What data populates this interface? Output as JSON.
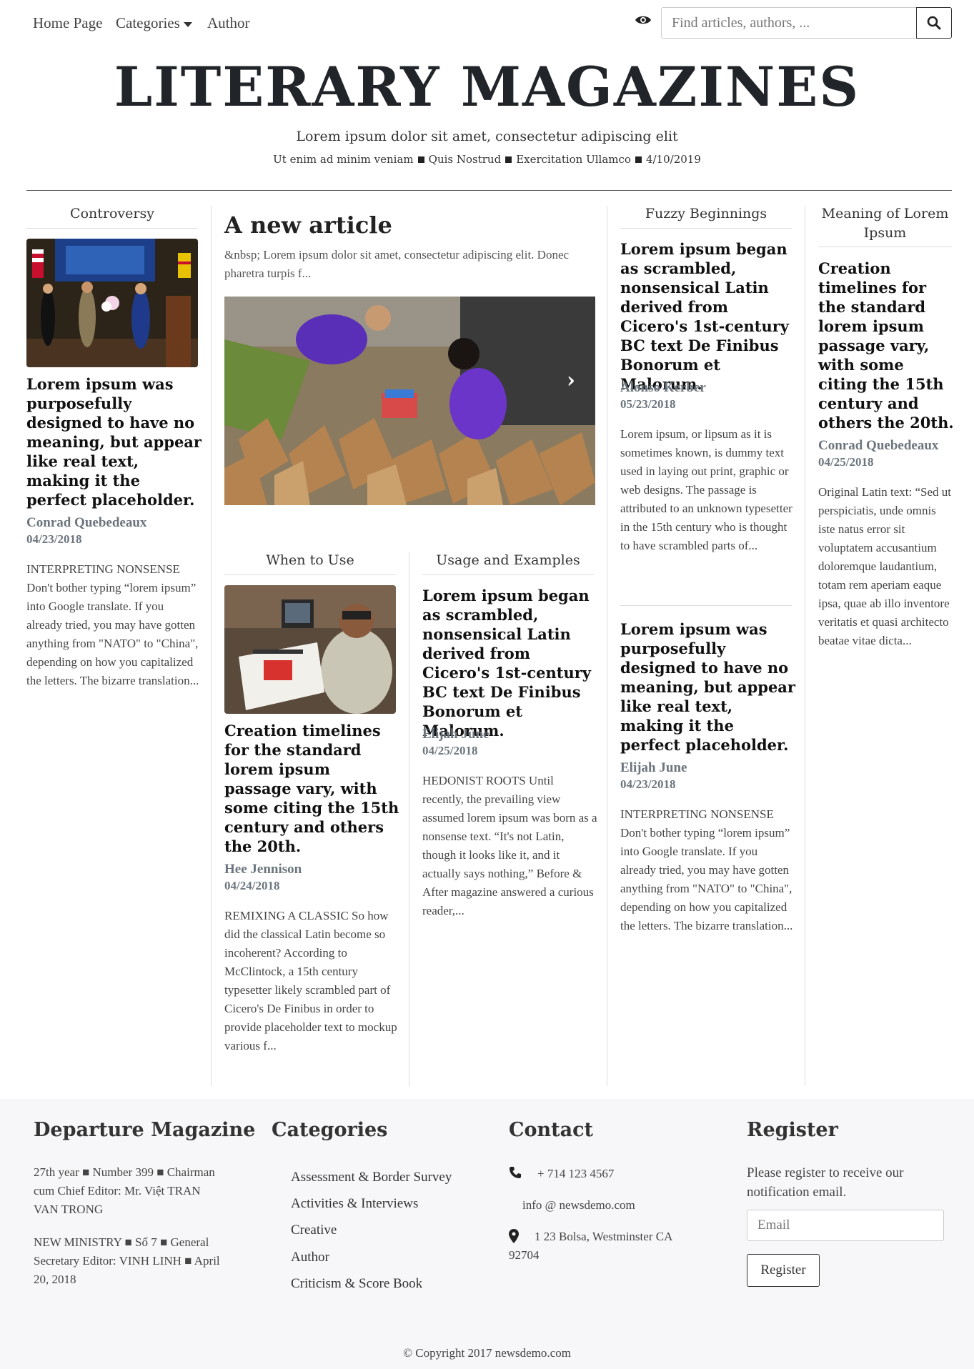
{
  "nav": {
    "items": [
      "Home Page",
      "Categories",
      "Author"
    ],
    "search_placeholder": "Find articles, authors, ..."
  },
  "masthead": {
    "title": "LITERARY MAGAZINES",
    "tagline": "Lorem ipsum dolor sit amet, consectetur adipiscing elit",
    "meta": [
      "Ut enim ad minim veniam",
      "Quis Nostrud",
      "Exercitation Ullamco",
      "4/10/2019"
    ]
  },
  "col1": {
    "section": "Controversy",
    "headline": "Lorem ipsum was purposefully designed to have no meaning, but appear like real text, making it the perfect placeholder.",
    "author": "Conrad Quebedeaux",
    "date": "04/23/2018",
    "excerpt": "INTERPRETING NONSENSE Don't bother typing “lorem ipsum” into Google translate. If you already tried, you may have gotten anything from \"NATO\" to \"China\", depending on how you capitalized the letters. The bizarre translation..."
  },
  "featured": {
    "title": "A new article",
    "text": "&nbsp; Lorem ipsum dolor sit amet, consectetur adipiscing elit. Donec pharetra turpis f..."
  },
  "sub1": {
    "section": "When to Use",
    "headline": "Creation timelines for the standard lorem ipsum passage vary, with some citing the 15th century and others the 20th.",
    "author": "Hee Jennison",
    "date": "04/24/2018",
    "excerpt": "REMIXING A CLASSIC So how did the classical Latin become so incoherent? According to McClintock, a 15th century typesetter likely scrambled part of Cicero's De Finibus in order to provide placeholder text to mockup various f..."
  },
  "sub2": {
    "section": "Usage and Examples",
    "headline": "Lorem ipsum began as scrambled, nonsensical Latin derived from Cicero's 1st-century BC text De Finibus Bonorum et Malorum.",
    "author": "Elijah June",
    "date": "04/25/2018",
    "excerpt": "HEDONIST ROOTS Until recently, the prevailing view assumed lorem ipsum was born as a nonsense text. “It's not Latin, though it looks like it, and it actually says nothing,” Before & After magazine answered a curious reader,..."
  },
  "col4": {
    "section": "Fuzzy Beginnings",
    "a1": {
      "headline": "Lorem ipsum began as scrambled, nonsensical Latin derived from Cicero's 1st-century BC text De Finibus Bonorum et Malorum.",
      "author": "Alonso Kerber",
      "date": "05/23/2018",
      "excerpt": "Lorem ipsum, or lipsum as it is sometimes known, is dummy text used in laying out print, graphic or web designs. The passage is attributed to an unknown typesetter in the 15th century who is thought to have scrambled parts of..."
    },
    "a2": {
      "headline": "Lorem ipsum was purposefully designed to have no meaning, but appear like real text, making it the perfect placeholder.",
      "author": "Elijah June",
      "date": "04/23/2018",
      "excerpt": "INTERPRETING NONSENSE Don't bother typing “lorem ipsum” into Google translate. If you already tried, you may have gotten anything from \"NATO\" to \"China\", depending on how you capitalized the letters. The bizarre translation..."
    }
  },
  "col5": {
    "section": "Meaning of Lorem Ipsum",
    "headline": "Creation timelines for the standard lorem ipsum passage vary, with some citing the 15th century and others the 20th.",
    "author": "Conrad Quebedeaux",
    "date": "04/25/2018",
    "excerpt": "Original Latin text: “Sed ut perspiciatis, unde omnis iste natus error sit voluptatem accusantium doloremque laudantium, totam rem aperiam eaque ipsa, quae ab illo inventore veritatis et quasi architecto beatae vitae dicta..."
  },
  "footer": {
    "about": {
      "title": "Departure Magazine",
      "p1": "27th year ■ Number 399 ■ Chairman cum Chief Editor: Mr. Việt TRAN VAN TRONG",
      "p2": "NEW MINISTRY ■ Số 7 ■ General Secretary Editor: VINH LINH ■ April 20, 2018"
    },
    "categories": {
      "title": "Categories",
      "items": [
        "Assessment & Border Survey",
        "Activities & Interviews",
        "Creative",
        "Author",
        "Criticism & Score Book"
      ]
    },
    "contact": {
      "title": "Contact",
      "phone": "+ 714 123 4567",
      "email": "info @ newsdemo.com",
      "address": "1 23 Bolsa, Westminster CA 92704"
    },
    "register": {
      "title": "Register",
      "text": "Please register to receive our notification email.",
      "email_placeholder": "Email",
      "button": "Register"
    },
    "copyright": "© Copyright 2017 newsdemo.com"
  }
}
